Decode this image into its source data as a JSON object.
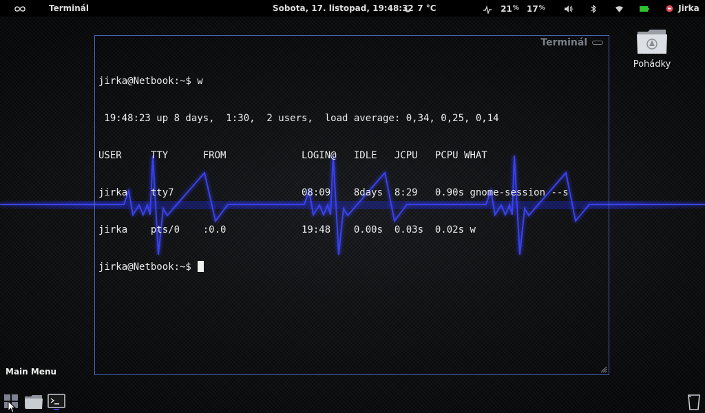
{
  "top_panel": {
    "active_app": "Terminál",
    "datetime": "Sobota, 17. listopad, 19:48:32",
    "weather": "7 °C",
    "cpu_value": "21",
    "cpu_unit": "%",
    "battery_value": "17",
    "battery_unit": "%",
    "user_name": "Jirka"
  },
  "terminal": {
    "title": "Terminál",
    "lines": [
      "jirka@Netbook:~$ w",
      " 19:48:23 up 8 days,  1:30,  2 users,  load average: 0,34, 0,25, 0,14",
      "USER     TTY      FROM             LOGIN@   IDLE   JCPU   PCPU WHAT",
      "jirka    tty7                      08:09    8days  8:29   0.90s gnome-session --s",
      "jirka    pts/0    :0.0             19:48    0.00s  0.03s  0.02s w"
    ],
    "prompt": "jirka@Netbook:~$ "
  },
  "desktop": {
    "folder_label": "Pohádky"
  },
  "main_menu": {
    "label": "Main Menu"
  },
  "colors": {
    "ecg": "#2e3cff",
    "window_border": "#4a63b8",
    "battery": "#2fc22f",
    "user_icon": "#e04a5a"
  },
  "icons": [
    "infinity-icon",
    "moon-icon",
    "pulse-icon",
    "volume-icon",
    "bluetooth-icon",
    "wifi-icon",
    "battery-icon",
    "user-status-icon",
    "folder-icon",
    "grid-menu-icon",
    "file-manager-icon",
    "terminal-icon",
    "trash-icon",
    "mouse-pointer-icon"
  ]
}
